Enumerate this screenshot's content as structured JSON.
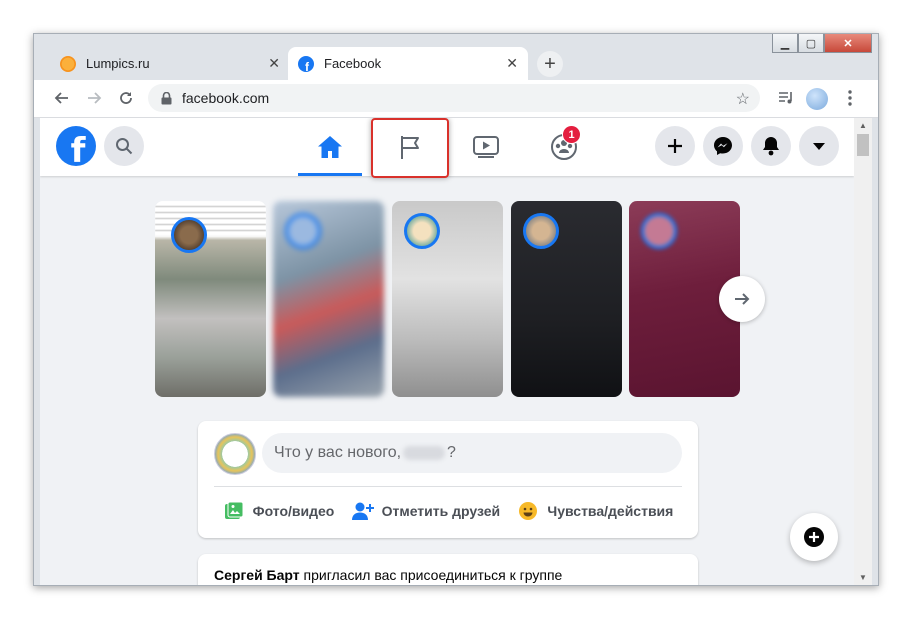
{
  "browser": {
    "tabs": [
      {
        "title": "Lumpics.ru",
        "favicon": "lumpics-favicon",
        "active": false
      },
      {
        "title": "Facebook",
        "favicon": "facebook-favicon",
        "active": true
      }
    ],
    "address": "facebook.com",
    "colors": {
      "tab_bar": "#dfe3e8",
      "toolbar": "#ffffff"
    }
  },
  "facebook": {
    "colors": {
      "brand": "#1877f2",
      "background": "#f0f2f5",
      "badge": "#e41e3f",
      "highlight": "#d9312b"
    },
    "nav_tabs": [
      {
        "name": "home",
        "icon": "home-icon",
        "active": true
      },
      {
        "name": "pages",
        "icon": "flag-icon",
        "active": false,
        "highlighted": true
      },
      {
        "name": "watch",
        "icon": "video-icon",
        "active": false
      },
      {
        "name": "groups",
        "icon": "groups-icon",
        "active": false,
        "badge": "1"
      }
    ],
    "right_actions": [
      "plus-icon",
      "messenger-icon",
      "notifications-icon",
      "account-menu-icon"
    ],
    "composer": {
      "placeholder_prefix": "Что у вас нового, ",
      "placeholder_suffix": "?",
      "actions": [
        {
          "label": "Фото/видео",
          "icon": "photo-icon",
          "color": "#45bd62"
        },
        {
          "label": "Отметить друзей",
          "icon": "tag-friends-icon",
          "color": "#1877f2"
        },
        {
          "label": "Чувства/действия",
          "icon": "feeling-icon",
          "color": "#f7b928"
        }
      ]
    },
    "feed": {
      "first_post_author": "Сергей Барт",
      "first_post_text": " пригласил вас присоединиться к группе"
    }
  }
}
